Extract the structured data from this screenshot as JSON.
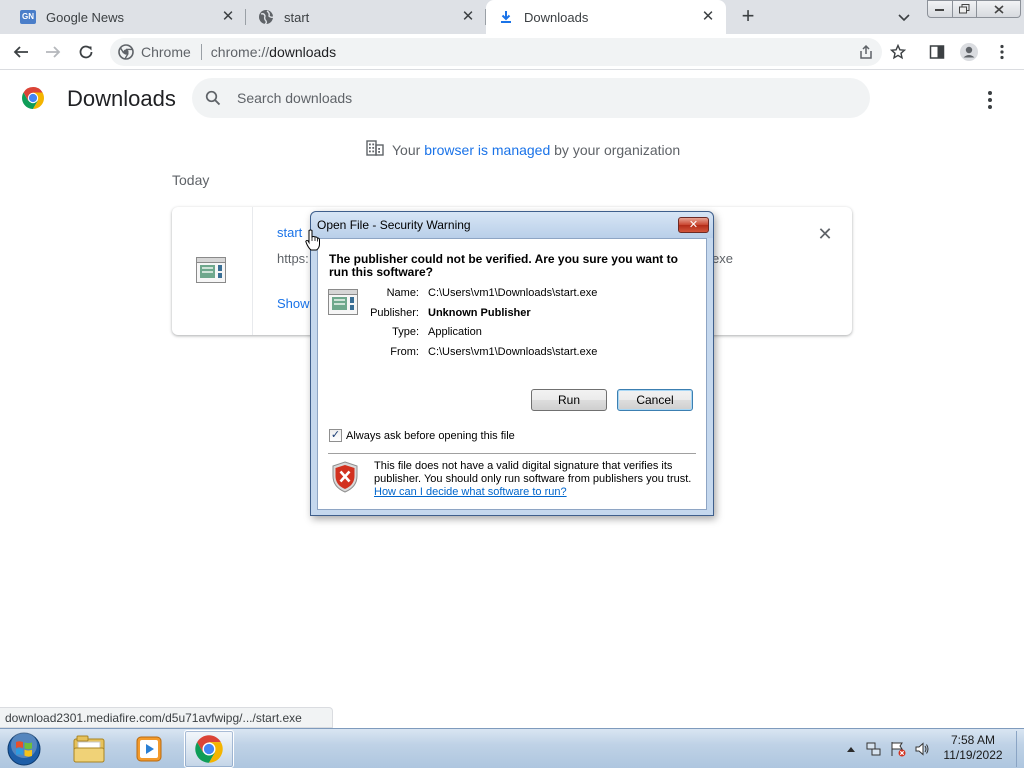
{
  "browser": {
    "tabs": [
      {
        "title": "Google News",
        "favicon": "google-news-icon",
        "active": false
      },
      {
        "title": "start",
        "favicon": "globe-icon",
        "active": false
      },
      {
        "title": "Downloads",
        "favicon": "download-icon",
        "active": true
      }
    ],
    "new_tab_label": "+",
    "omnibox": {
      "chip_label": "Chrome",
      "url_scheme": "chrome://",
      "url_host": "downloads"
    }
  },
  "page": {
    "title": "Downloads",
    "search_placeholder": "Search downloads",
    "managed_prefix": "Your ",
    "managed_link": "browser is managed",
    "managed_suffix": " by your organization",
    "section_today": "Today",
    "download_item": {
      "name": "start",
      "url_prefix": "https:",
      "url_suffix": "exe",
      "show_label": "Show"
    }
  },
  "dialog": {
    "title": "Open File - Security Warning",
    "question": "The publisher could not be verified.  Are you sure you want to run this software?",
    "fields": [
      {
        "label": "Name:",
        "value": "C:\\Users\\vm1\\Downloads\\start.exe",
        "bold": false
      },
      {
        "label": "Publisher:",
        "value": "Unknown Publisher",
        "bold": true
      },
      {
        "label": "Type:",
        "value": "Application",
        "bold": false
      },
      {
        "label": "From:",
        "value": "C:\\Users\\vm1\\Downloads\\start.exe",
        "bold": false
      }
    ],
    "run_label": "Run",
    "cancel_label": "Cancel",
    "checkbox_label": "Always ask before opening this file",
    "checkbox_checked": true,
    "warning_text": "This file does not have a valid digital signature that verifies its publisher.  You should only run software from publishers you trust.",
    "help_link": "How can I decide what software to run?"
  },
  "status_url": "download2301.mediafire.com/d5u71avfwipg/.../start.exe",
  "taskbar": {
    "clock_time": "7:58 AM",
    "clock_date": "11/19/2022",
    "pinned": [
      "windows-explorer-icon",
      "media-player-icon",
      "chrome-icon"
    ]
  },
  "colors": {
    "accent": "#1a73e8",
    "tabstrip": "#dee1e6",
    "dialog_frame": "#c5d8ee"
  }
}
